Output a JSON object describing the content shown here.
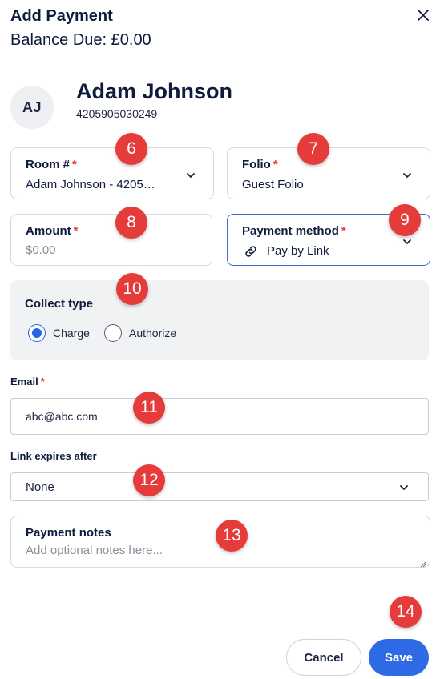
{
  "header": {
    "title": "Add Payment",
    "balance": "Balance Due: £0.00",
    "close_icon": "close-icon"
  },
  "guest": {
    "initials": "AJ",
    "name": "Adam Johnson",
    "id": "4205905030249"
  },
  "room": {
    "label": "Room #",
    "required": "*",
    "value": "Adam Johnson - 4205…"
  },
  "folio": {
    "label": "Folio",
    "required": "*",
    "value": "Guest Folio"
  },
  "amount": {
    "label": "Amount",
    "required": "*",
    "placeholder": "$0.00"
  },
  "payment_method": {
    "label": "Payment method",
    "required": "*",
    "value": "Pay by Link",
    "icon": "link-icon"
  },
  "collect_type": {
    "label": "Collect type",
    "options": [
      "Charge",
      "Authorize"
    ],
    "selected": "Charge"
  },
  "email": {
    "label": "Email",
    "required": "*",
    "value": "abc@abc.com"
  },
  "link_expires": {
    "label": "Link expires after",
    "value": "None"
  },
  "payment_notes": {
    "label": "Payment notes",
    "placeholder": "Add optional notes here..."
  },
  "buttons": {
    "cancel": "Cancel",
    "save": "Save"
  },
  "markers": [
    "6",
    "7",
    "8",
    "9",
    "10",
    "11",
    "12",
    "13",
    "14"
  ],
  "colors": {
    "accent": "#2f6ae6",
    "required": "#e23b3b",
    "marker": "#e63b3b",
    "text": "#0f1b3d"
  }
}
